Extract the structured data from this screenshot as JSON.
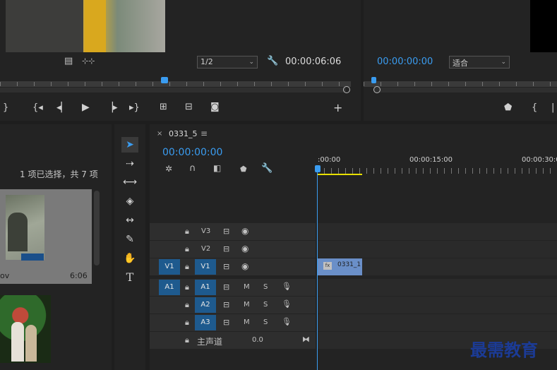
{
  "source_monitor": {
    "scale": "1/2",
    "timecode": "00:00:06:06"
  },
  "program_monitor": {
    "timecode": "00:00:00:00",
    "fit": "适合"
  },
  "project": {
    "selection_info": "1 项已选择，共 7 项",
    "clip1_name": "ov",
    "clip1_duration": "6:06"
  },
  "timeline": {
    "tab_name": "0331_5",
    "timecode": "00:00:00:00",
    "ruler_labels": [
      ":00:00",
      "00:00:15:00",
      "00:00:30:0"
    ],
    "tracks": {
      "v3": "V3",
      "v2": "V2",
      "v1": "V1",
      "v1_src": "V1",
      "a1": "A1",
      "a1_src": "A1",
      "a2": "A2",
      "a3": "A3",
      "mute": "M",
      "solo": "S",
      "master": "主声道",
      "master_value": "0.0"
    },
    "clip_label": "0331_1",
    "clip_fx": "fx"
  },
  "watermark": "最需教育",
  "colors": {
    "accent": "#3a9cf0",
    "track_toggle": "#1e5a8e",
    "clip": "#6a8fc8"
  }
}
